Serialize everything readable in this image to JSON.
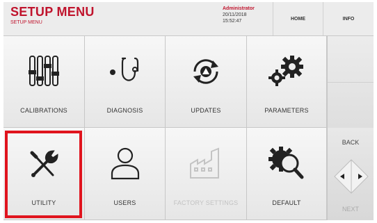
{
  "header": {
    "title": "SETUP MENU",
    "subtitle": "SETUP MENU",
    "user": "Administrator",
    "date": "20/11/2018",
    "time": "15:52:47",
    "home_label": "HOME",
    "info_label": "INFO"
  },
  "menu": {
    "calibrations": "CALIBRATIONS",
    "diagnosis": "DIAGNOSIS",
    "updates": "UPDATES",
    "parameters": "PARAMETERS",
    "utility": "UTILITY",
    "users": "USERS",
    "factory_settings": "FACTORY SETTINGS",
    "default": "DEFAULT"
  },
  "nav": {
    "back_label": "BACK",
    "next_label": "NEXT"
  },
  "colors": {
    "accent": "#c0142d",
    "highlight": "#e0141e"
  }
}
